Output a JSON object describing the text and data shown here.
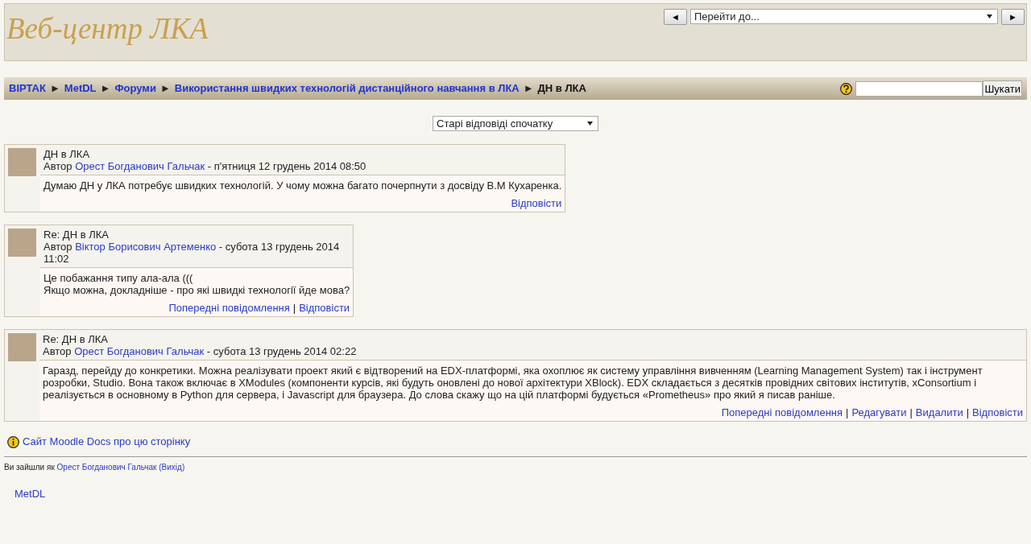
{
  "header": {
    "site_title": "Веб-центр ЛКА",
    "prev_button": "◄",
    "next_button": "►",
    "jump_select": "Перейти до..."
  },
  "breadcrumb": {
    "separator": "►",
    "items": [
      {
        "text": "ВІРТАК",
        "link": true
      },
      {
        "text": "MetDL",
        "link": true
      },
      {
        "text": "Форуми",
        "link": true
      },
      {
        "text": "Використання швидких технологій дистанційного навчання в ЛКА",
        "link": true
      },
      {
        "text": "ДН в ЛКА",
        "link": false
      }
    ]
  },
  "search": {
    "button": "Шукати"
  },
  "sort_select": "Старі відповіді спочатку",
  "posts": [
    {
      "subject": "ДН в ЛКА",
      "by": "Автор",
      "author": "Орест Богданович Гальчак",
      "date": " - п'ятниця 12 грудень 2014 08:50",
      "body": [
        "Думаю ДН у ЛКА потребує швидких технологій. У чому можна багато почерпнути з досвіду В.М Кухаренка."
      ],
      "actions": [
        "Відповісти"
      ]
    },
    {
      "subject": "Re: ДН в ЛКА",
      "by": "Автор",
      "author": "Віктор Борисович Артеменко",
      "date": " - субота 13 грудень 2014 11:02",
      "body": [
        "Це побажання типу ала-ала (((",
        "Якщо можна, докладніше - про які швидкі технології йде мова?"
      ],
      "actions": [
        "Попередні повідомлення",
        "Відповісти"
      ]
    },
    {
      "subject": "Re: ДН в ЛКА",
      "by": "Автор",
      "author": "Орест Богданович Гальчак",
      "date": " - субота 13 грудень 2014 02:22",
      "body": [
        "Гаразд, перейду до конкретики. Можна реалізувати проект який є відтворений на EDX-платформі, яка охоплює як систему управління вивченням (Learning Management System) так і інструмент розробки, Studio. Вона також включає в XModules (компоненти курсів, які будуть оновлені до нової архітектури XBlock). EDX складається з десятків провідних світових інститутів, xConsortium і реалізується в основному в Python для сервера, і Javascript для браузера. До слова скажу що на цій платформі будується «Prometheus» про який я писав раніше."
      ],
      "actions": [
        "Попередні повідомлення",
        "Редагувати",
        "Видалити",
        "Відповісти"
      ]
    }
  ],
  "action_separator": "|",
  "docs_link": "Сайт Moodle Docs про цю сторінку",
  "login_info": {
    "prefix": "Ви зайшли як ",
    "user": "Орест Богданович Гальчак",
    "logout": "(Вихід)"
  },
  "footer_link": "MetDL"
}
